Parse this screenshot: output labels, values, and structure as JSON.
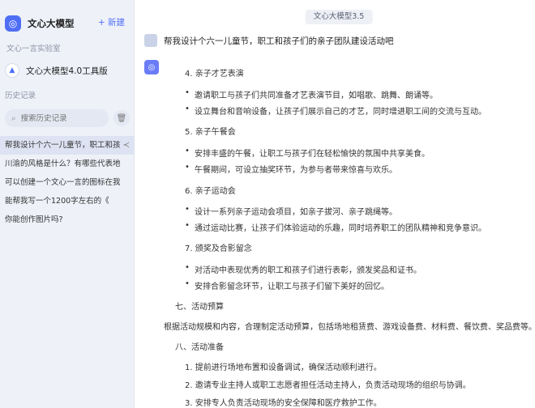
{
  "sidebar": {
    "app_title": "文心大模型",
    "new_label": "+ 新建",
    "lab_label": "文心一言实验室",
    "tool_label": "文心大模型4.0工具版",
    "history_label": "历史记录",
    "search_placeholder": "搜索历史记录",
    "history": [
      "帮我设计个六一儿童节，职工和孩",
      "川渝的风格是什么？有哪些代表地",
      "可以创建一个文心一言的图标在我",
      "能帮我写一个1200字左右的《",
      "你能创作图片吗?"
    ]
  },
  "main": {
    "model_label": "文心大模型3.5",
    "user_message": "帮我设计个六一儿童节，职工和孩子们的亲子团队建设活动吧",
    "answer": {
      "h4": "4. 亲子才艺表演",
      "b4a": "邀请职工与孩子们共同准备才艺表演节目，如唱歌、跳舞、朗诵等。",
      "b4b": "设立舞台和音响设备，让孩子们展示自己的才艺，同时增进职工间的交流与互动。",
      "h5": "5. 亲子午餐会",
      "b5a": "安排丰盛的午餐，让职工与孩子们在轻松愉快的氛围中共享美食。",
      "b5b": "午餐期间，可设立抽奖环节，为参与者带来惊喜与欢乐。",
      "h6": "6. 亲子运动会",
      "b6a": "设计一系列亲子运动会项目，如亲子拔河、亲子跳绳等。",
      "b6b": "通过运动比赛，让孩子们体验运动的乐趣，同时培养职工的团队精神和竞争意识。",
      "h7": "7. 颁奖及合影留念",
      "b7a": "对活动中表现优秀的职工和孩子们进行表彰，颁发奖品和证书。",
      "b7b": "安排合影留念环节，让职工与孩子们留下美好的回忆。",
      "s7": "七、活动预算",
      "p7": "根据活动规模和内容，合理制定活动预算，包括场地租赁费、游戏设备费、材料费、餐饮费、奖品费等。",
      "s8": "八、活动准备",
      "n1": "1. 提前进行场地布置和设备调试，确保活动顺利进行。",
      "n2": "2. 邀请专业主持人或职工志愿者担任活动主持人，负责活动现场的组织与协调。",
      "n3": "3. 安排专人负责活动现场的安全保障和医疗救护工作。"
    }
  }
}
